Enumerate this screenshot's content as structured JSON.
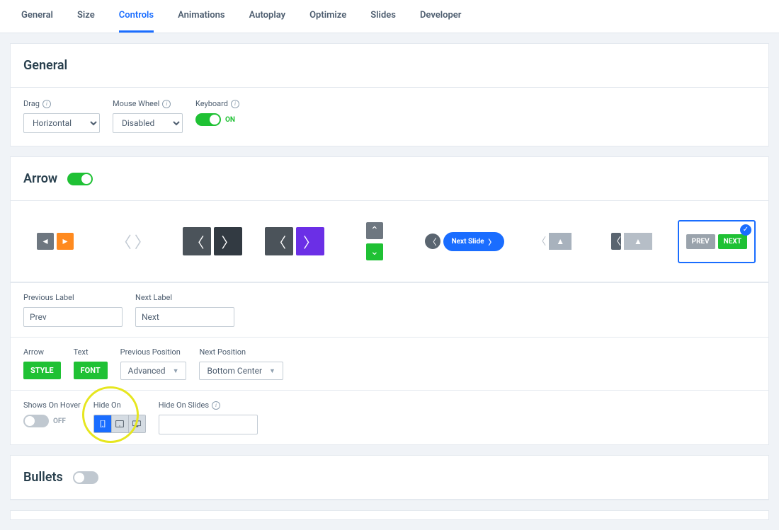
{
  "tabs": {
    "items": [
      "General",
      "Size",
      "Controls",
      "Animations",
      "Autoplay",
      "Optimize",
      "Slides",
      "Developer"
    ],
    "active": "Controls"
  },
  "general": {
    "title": "General",
    "drag": {
      "label": "Drag",
      "value": "Horizontal"
    },
    "mousewheel": {
      "label": "Mouse Wheel",
      "value": "Disabled"
    },
    "keyboard": {
      "label": "Keyboard",
      "state": "ON"
    }
  },
  "arrow": {
    "title": "Arrow",
    "enabled": true,
    "styles": {
      "next_slide_pill": "Next Slide",
      "prev_text": "PREV",
      "next_text": "NEXT"
    },
    "previous_label": {
      "label": "Previous Label",
      "value": "Prev"
    },
    "next_label": {
      "label": "Next Label",
      "value": "Next"
    },
    "arrow_btn": {
      "label": "Arrow",
      "button": "STYLE"
    },
    "text_btn": {
      "label": "Text",
      "button": "FONT"
    },
    "previous_position": {
      "label": "Previous Position",
      "value": "Advanced"
    },
    "next_position": {
      "label": "Next Position",
      "value": "Bottom Center"
    },
    "shows_on_hover": {
      "label": "Shows On Hover",
      "state": "OFF"
    },
    "hide_on": {
      "label": "Hide On",
      "options": [
        "mobile",
        "tablet",
        "desktop"
      ],
      "active": "mobile"
    },
    "hide_on_slides": {
      "label": "Hide On Slides",
      "value": ""
    }
  },
  "bullets": {
    "title": "Bullets",
    "enabled": false
  }
}
